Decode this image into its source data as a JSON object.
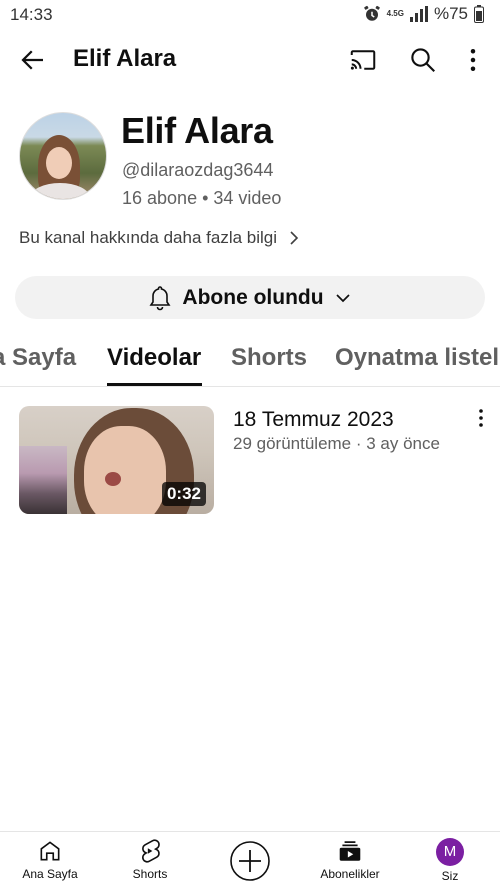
{
  "status_bar": {
    "time": "14:33",
    "network": "4.5G",
    "battery": "%75"
  },
  "app_bar": {
    "title": "Elif Alara"
  },
  "channel": {
    "name": "Elif Alara",
    "handle": "@dilaraozdag3644",
    "stats": "16 abone • 34 video",
    "about_link": "Bu kanal hakkında daha fazla bilgi"
  },
  "subscribe_button": {
    "label": "Abone olundu"
  },
  "tabs": [
    {
      "label": "Ana Sayfa",
      "active": false
    },
    {
      "label": "Videolar",
      "active": true
    },
    {
      "label": "Shorts",
      "active": false
    },
    {
      "label": "Oynatma listeleri",
      "active": false
    }
  ],
  "videos": [
    {
      "title": "18 Temmuz 2023",
      "meta": "29 görüntüleme · 3 ay önce",
      "duration": "0:32"
    }
  ],
  "bottom_nav": {
    "home": "Ana Sayfa",
    "shorts": "Shorts",
    "subscriptions": "Abonelikler",
    "you": "Siz",
    "avatar_letter": "M",
    "avatar_color": "#7b1fa2"
  },
  "icons": [
    "back-arrow-icon",
    "cast-icon",
    "search-icon",
    "more-vert-icon",
    "bell-icon",
    "chevron-down-icon",
    "chevron-right-icon",
    "home-icon",
    "shorts-icon",
    "create-plus-icon",
    "subscriptions-icon"
  ]
}
